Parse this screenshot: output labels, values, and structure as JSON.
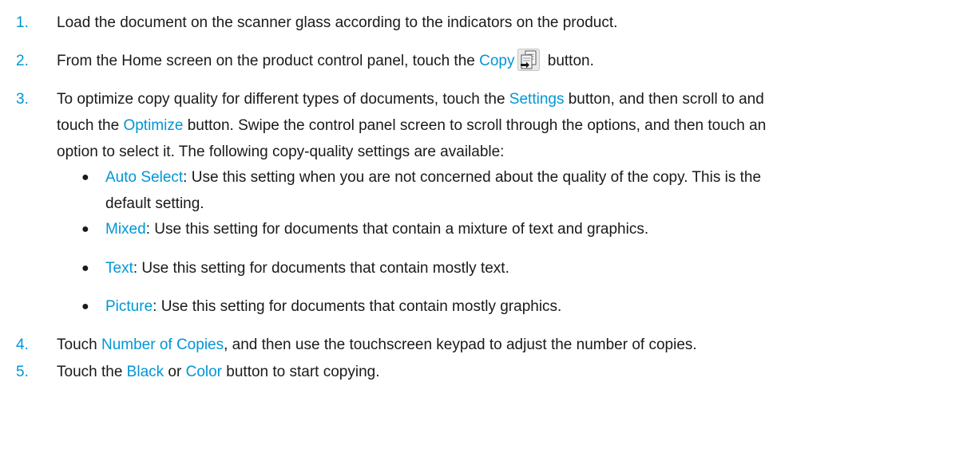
{
  "steps": [
    {
      "number": "1.",
      "text": "Load the document on the scanner glass according to the indicators on the product."
    },
    {
      "number": "2.",
      "before": "From the Home screen on the product control panel, touch the ",
      "ui_copy": "Copy",
      "after": " button.",
      "icon": "copy-icon"
    },
    {
      "number": "3.",
      "part1": "To optimize copy quality for different types of documents, touch the ",
      "ui_settings": "Settings",
      "part2": " button, and then scroll to and",
      "part3": "touch the ",
      "ui_optimize": "Optimize",
      "part4": " button. Swipe the control panel screen to scroll through the options, and then touch an",
      "part5": "option to select it. The following copy-quality settings are available:",
      "bullets": [
        {
          "symbol": "●",
          "label": "Auto Select",
          "text": ": Use this setting when you are not concerned about the quality of the copy. This is the",
          "text_line2": "default setting."
        },
        {
          "symbol": "●",
          "label": "Mixed",
          "text": ": Use this setting for documents that contain a mixture of text and graphics."
        },
        {
          "symbol": "●",
          "label": "Text",
          "text": ": Use this setting for documents that contain mostly text."
        },
        {
          "symbol": "●",
          "label": "Picture",
          "text": ": Use this setting for documents that contain mostly graphics."
        }
      ]
    },
    {
      "number": "4.",
      "before": "Touch ",
      "ui_copies": "Number of Copies",
      "after": ", and then use the touchscreen keypad to adjust the number of copies."
    },
    {
      "number": "5.",
      "before": "Touch the ",
      "ui_black": "Black",
      "middle": " or ",
      "ui_color": "Color",
      "after": " button to start copying."
    }
  ],
  "colors": {
    "accent": "#0096d6",
    "text": "#1a1a1a"
  }
}
